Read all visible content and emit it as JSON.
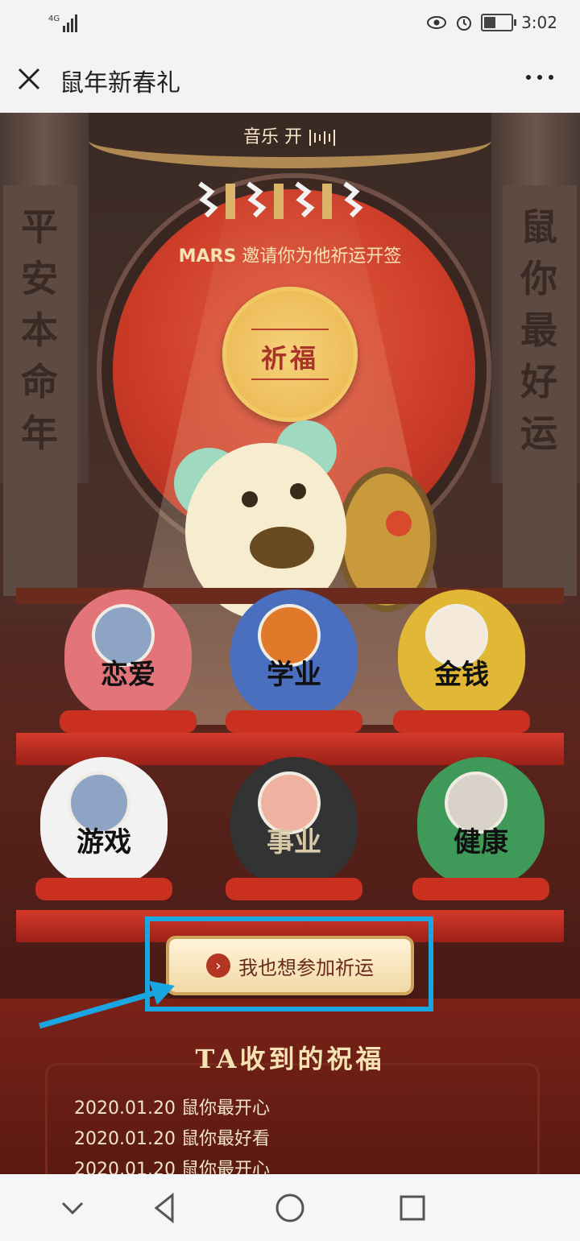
{
  "status_bar": {
    "network": "4G",
    "time": "3:02"
  },
  "title_bar": {
    "title": "鼠年新春礼"
  },
  "scene": {
    "music_label": "音乐 开",
    "invite_name": "MARS",
    "invite_text": " 邀请你为他祈运开签",
    "coin_label": "祈福",
    "left_scroll": "平安本命年",
    "right_scroll": "鼠你最好运"
  },
  "darumas": [
    {
      "label": "恋爱",
      "color": "#e2747a"
    },
    {
      "label": "学业",
      "color": "#4a6fbe"
    },
    {
      "label": "金钱",
      "color": "#e0b836"
    },
    {
      "label": "游戏",
      "color": "#f2f2f2"
    },
    {
      "label": "事业",
      "color": "#333333"
    },
    {
      "label": "健康",
      "color": "#3f9a5a"
    }
  ],
  "join_button": {
    "label": "我也想参加祈运"
  },
  "blessings": {
    "title": "TA收到的祝福",
    "items": [
      "2020.01.20 鼠你最开心",
      "2020.01.20 鼠你最好看",
      "2020.01.20 鼠你最开心"
    ]
  },
  "colors": {
    "highlight": "#1aa6e0",
    "accent": "#b33622"
  }
}
